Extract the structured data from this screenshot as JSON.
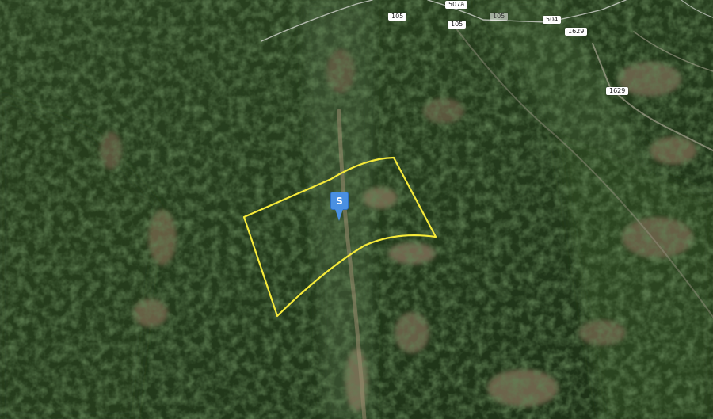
{
  "map": {
    "type": "satellite",
    "colors": {
      "forest_dark": "#1f3317",
      "forest_mid": "#2f4a24",
      "forest_light": "#3d5a2e",
      "clearing": "#8a7a5e",
      "boundary": "#f5ea3a",
      "road_trace": "#cfd2cc",
      "marker": "#4a90e2"
    },
    "road_labels": [
      {
        "text": "507a",
        "faded": false
      },
      {
        "text": "105",
        "faded": true
      },
      {
        "text": "105",
        "faded": false
      },
      {
        "text": "105",
        "faded": false
      },
      {
        "text": "504",
        "faded": false
      },
      {
        "text": "1629",
        "faded": false
      },
      {
        "text": "1629",
        "faded": false
      }
    ],
    "marker": {
      "letter": "S",
      "icon": "property-pin-icon"
    }
  }
}
